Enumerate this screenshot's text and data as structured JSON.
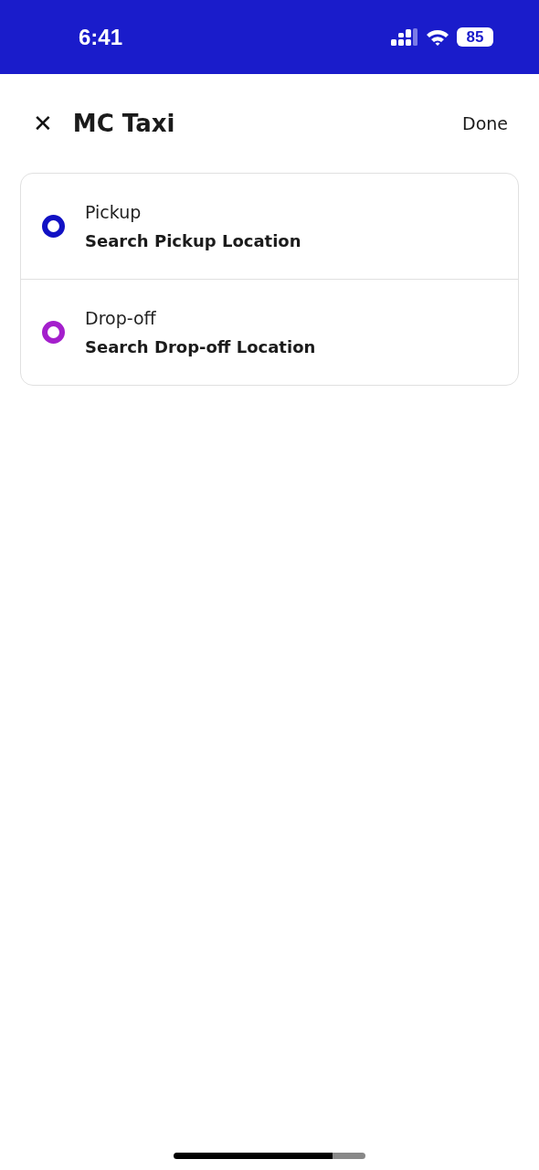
{
  "status_bar": {
    "time": "6:41",
    "battery": "85"
  },
  "header": {
    "close": "✕",
    "title": "MC Taxi",
    "action": "Done"
  },
  "stops": [
    {
      "label": "Pickup",
      "placeholder": "Search Pickup Location",
      "color": "#1111c4"
    },
    {
      "label": "Drop-off",
      "placeholder": "Search Drop-off Location",
      "color": "#a41fcc"
    }
  ]
}
